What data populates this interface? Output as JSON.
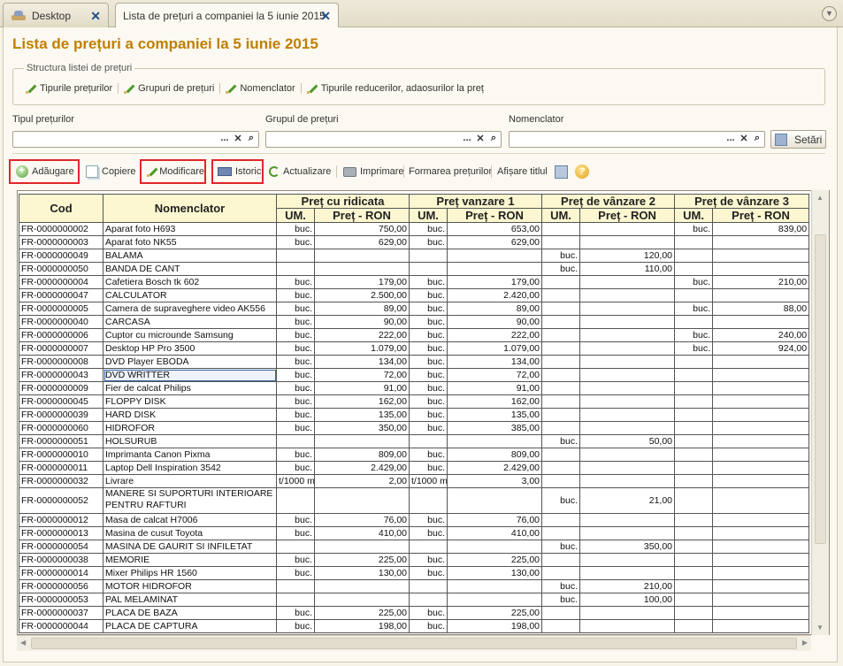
{
  "tabs": [
    {
      "label": "Desktop"
    },
    {
      "label": "Lista de prețuri a companiei la 5 iunie 2015"
    }
  ],
  "page_title": "Lista de prețuri a companiei la 5 iunie 2015",
  "structure": {
    "legend": "Structura listei de prețuri",
    "links": [
      "Tipurile prețurilor",
      "Grupuri de prețuri",
      "Nomenclator",
      "Tipurile reducerilor, adaosurilor la preț"
    ]
  },
  "filters": {
    "price_type_label": "Tipul prețurilor",
    "price_group_label": "Grupul de prețuri",
    "nomenclature_label": "Nomenclator",
    "settings_label": "Setări",
    "dots": "...",
    "clear": "✕",
    "search": "🔍"
  },
  "toolbar": {
    "add": "Adăugare",
    "copy": "Copiere",
    "modify": "Modificare",
    "history": "Istoric",
    "refresh": "Actualizare",
    "print": "Imprimare",
    "form_prices": "Formarea prețurilor",
    "show_title": "Afișare titlul"
  },
  "grid": {
    "col_code": "Cod",
    "col_nom": "Nomenclator",
    "groups": [
      "Preț cu ridicata",
      "Preț vanzare 1",
      "Preț de vânzare 2",
      "Preț de vânzare 3"
    ],
    "sub_um": "UM.",
    "sub_price": "Preț - RON",
    "rows": [
      [
        "FR-0000000002",
        "Aparat foto H693",
        "buc.",
        "750,00",
        "buc.",
        "653,00",
        "",
        "",
        "buc.",
        "839,00"
      ],
      [
        "FR-0000000003",
        "Aparat foto NK55",
        "buc.",
        "629,00",
        "buc.",
        "629,00",
        "",
        "",
        "",
        ""
      ],
      [
        "FR-0000000049",
        "BALAMA",
        "",
        "",
        "",
        "",
        "buc.",
        "120,00",
        "",
        ""
      ],
      [
        "FR-0000000050",
        "BANDA DE CANT",
        "",
        "",
        "",
        "",
        "buc.",
        "110,00",
        "",
        ""
      ],
      [
        "FR-0000000004",
        "Cafetiera Bosch tk 602",
        "buc.",
        "179,00",
        "buc.",
        "179,00",
        "",
        "",
        "buc.",
        "210,00"
      ],
      [
        "FR-0000000047",
        "CALCULATOR",
        "buc.",
        "2.500,00",
        "buc.",
        "2.420,00",
        "",
        "",
        "",
        ""
      ],
      [
        "FR-0000000005",
        "Camera de supraveghere video AK556",
        "buc.",
        "89,00",
        "buc.",
        "89,00",
        "",
        "",
        "buc.",
        "88,00"
      ],
      [
        "FR-0000000040",
        "CARCASA",
        "buc.",
        "90,00",
        "buc.",
        "90,00",
        "",
        "",
        "",
        ""
      ],
      [
        "FR-0000000006",
        "Cuptor cu microunde Samsung",
        "buc.",
        "222,00",
        "buc.",
        "222,00",
        "",
        "",
        "buc.",
        "240,00"
      ],
      [
        "FR-0000000007",
        "Desktop HP Pro 3500",
        "buc.",
        "1.079,00",
        "buc.",
        "1.079,00",
        "",
        "",
        "buc.",
        "924,00"
      ],
      [
        "FR-0000000008",
        "DVD Player EBODA",
        "buc.",
        "134,00",
        "buc.",
        "134,00",
        "",
        "",
        "",
        ""
      ],
      [
        "FR-0000000043",
        "DVD WRITTER",
        "buc.",
        "72,00",
        "buc.",
        "72,00",
        "",
        "",
        "",
        ""
      ],
      [
        "FR-0000000009",
        "Fier de calcat Philips",
        "buc.",
        "91,00",
        "buc.",
        "91,00",
        "",
        "",
        "",
        ""
      ],
      [
        "FR-0000000045",
        "FLOPPY DISK",
        "buc.",
        "162,00",
        "buc.",
        "162,00",
        "",
        "",
        "",
        ""
      ],
      [
        "FR-0000000039",
        "HARD DISK",
        "buc.",
        "135,00",
        "buc.",
        "135,00",
        "",
        "",
        "",
        ""
      ],
      [
        "FR-0000000060",
        "HIDROFOR",
        "buc.",
        "350,00",
        "buc.",
        "385,00",
        "",
        "",
        "",
        ""
      ],
      [
        "FR-0000000051",
        "HOLSURUB",
        "",
        "",
        "",
        "",
        "buc.",
        "50,00",
        "",
        ""
      ],
      [
        "FR-0000000010",
        "Imprimanta Canon Pixma",
        "buc.",
        "809,00",
        "buc.",
        "809,00",
        "",
        "",
        "",
        ""
      ],
      [
        "FR-0000000011",
        "Laptop Dell Inspiration 3542",
        "buc.",
        "2.429,00",
        "buc.",
        "2.429,00",
        "",
        "",
        "",
        ""
      ],
      [
        "FR-0000000032",
        "Livrare",
        "t/1000 m",
        "2,00",
        "t/1000 m",
        "3,00",
        "",
        "",
        "",
        ""
      ],
      [
        "FR-0000000052",
        "MANERE SI SUPORTURI INTERIOARE PENTRU RAFTURI",
        "",
        "",
        "",
        "",
        "buc.",
        "21,00",
        "",
        ""
      ],
      [
        "FR-0000000012",
        "Masa de calcat H7006",
        "buc.",
        "76,00",
        "buc.",
        "76,00",
        "",
        "",
        "",
        ""
      ],
      [
        "FR-0000000013",
        "Masina de cusut Toyota",
        "buc.",
        "410,00",
        "buc.",
        "410,00",
        "",
        "",
        "",
        ""
      ],
      [
        "FR-0000000054",
        "MASINA DE GAURIT SI INFILETAT",
        "",
        "",
        "",
        "",
        "buc.",
        "350,00",
        "",
        ""
      ],
      [
        "FR-0000000038",
        "MEMORIE",
        "buc.",
        "225,00",
        "buc.",
        "225,00",
        "",
        "",
        "",
        ""
      ],
      [
        "FR-0000000014",
        "Mixer Philips HR 1560",
        "buc.",
        "130,00",
        "buc.",
        "130,00",
        "",
        "",
        "",
        ""
      ],
      [
        "FR-0000000056",
        "MOTOR HIDROFOR",
        "",
        "",
        "",
        "",
        "buc.",
        "210,00",
        "",
        ""
      ],
      [
        "FR-0000000053",
        "PAL MELAMINAT",
        "",
        "",
        "",
        "",
        "buc.",
        "100,00",
        "",
        ""
      ],
      [
        "FR-0000000037",
        "PLACA DE BAZA",
        "buc.",
        "225,00",
        "buc.",
        "225,00",
        "",
        "",
        "",
        ""
      ],
      [
        "FR-0000000044",
        "PLACA DE CAPTURA",
        "buc.",
        "198,00",
        "buc.",
        "198,00",
        "",
        "",
        "",
        ""
      ]
    ],
    "selected_row": 11
  },
  "colors": {
    "title": "#c17f00",
    "header_bg": "#fcf7d0",
    "highlight": "#e0262a"
  }
}
